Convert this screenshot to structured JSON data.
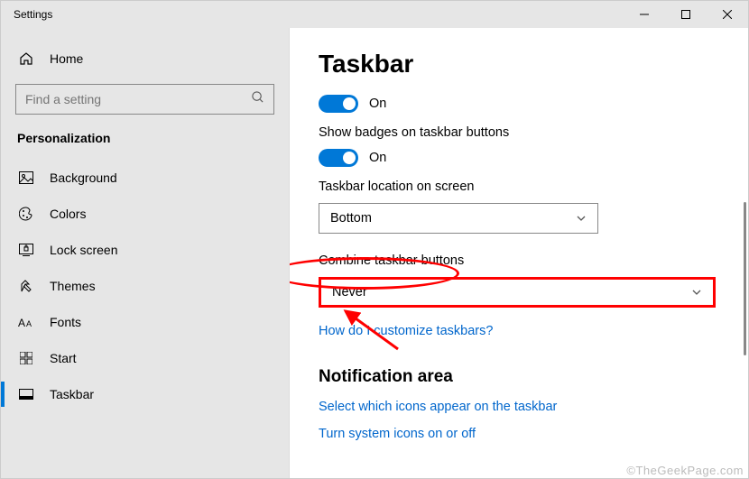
{
  "window": {
    "title": "Settings"
  },
  "sidebar": {
    "home": "Home",
    "search_placeholder": "Find a setting",
    "section": "Personalization",
    "items": [
      {
        "label": "Background"
      },
      {
        "label": "Colors"
      },
      {
        "label": "Lock screen"
      },
      {
        "label": "Themes"
      },
      {
        "label": "Fonts"
      },
      {
        "label": "Start"
      },
      {
        "label": "Taskbar"
      }
    ]
  },
  "page": {
    "title": "Taskbar",
    "toggle1_state": "On",
    "badges_label": "Show badges on taskbar buttons",
    "toggle2_state": "On",
    "location_label": "Taskbar location on screen",
    "location_value": "Bottom",
    "combine_label": "Combine taskbar buttons",
    "combine_value": "Never",
    "help_link": "How do I customize taskbars?",
    "notif_heading": "Notification area",
    "notif_link1": "Select which icons appear on the taskbar",
    "notif_link2": "Turn system icons on or off"
  },
  "watermark": "©TheGeekPage.com"
}
